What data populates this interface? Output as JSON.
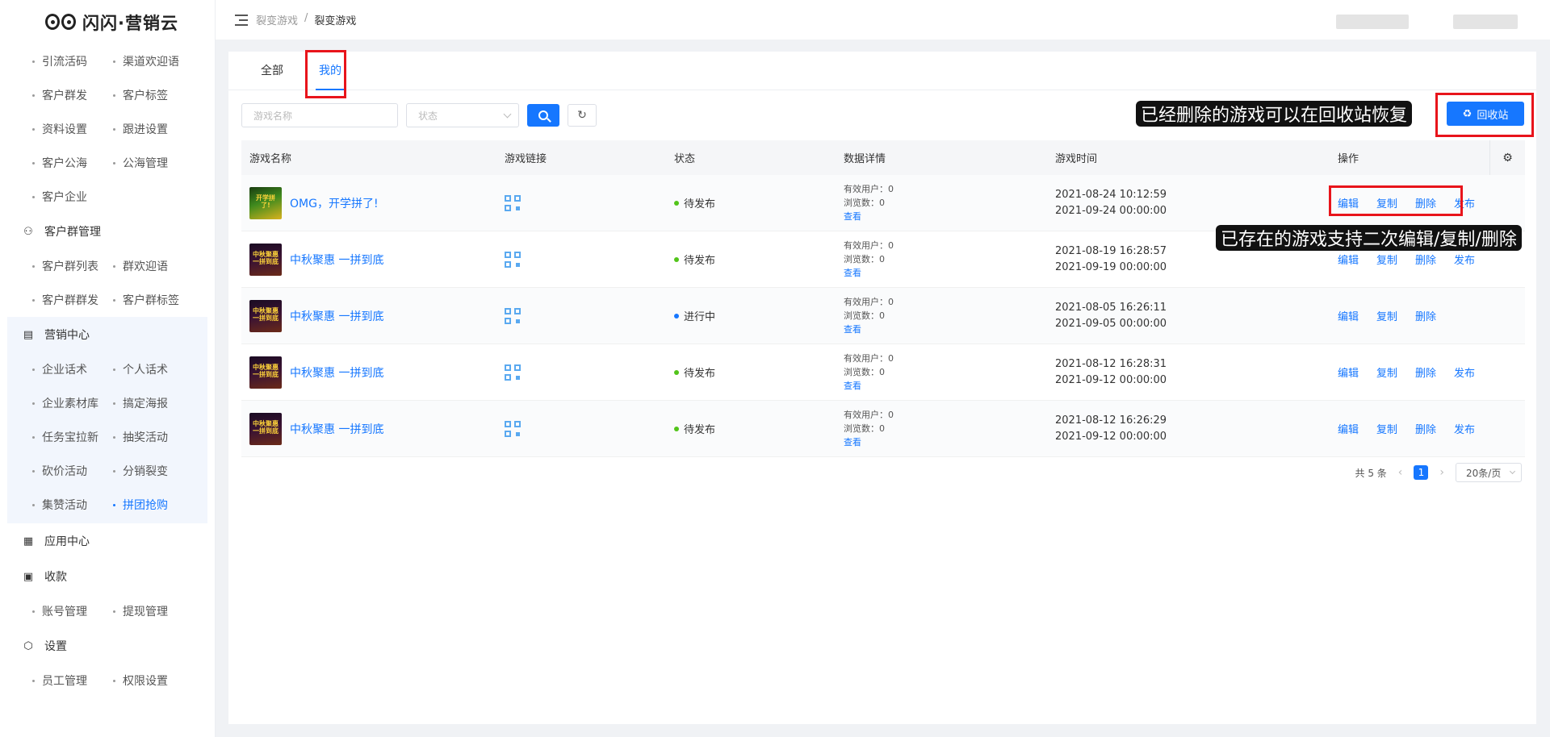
{
  "brand": {
    "name": "闪闪·营销云"
  },
  "sidebar": {
    "top_items": [
      "引流活码",
      "渠道欢迎语",
      "客户群发",
      "客户标签",
      "资料设置",
      "跟进设置",
      "客户公海",
      "公海管理",
      "客户企业"
    ],
    "groups": [
      {
        "title": "客户群管理",
        "icon": "group-users-icon",
        "items": [
          "客户群列表",
          "群欢迎语",
          "客户群群发",
          "客户群标签"
        ]
      },
      {
        "title": "营销中心",
        "icon": "chart-line-icon",
        "items": [
          "企业话术",
          "个人话术",
          "企业素材库",
          "搞定海报",
          "任务宝拉新",
          "抽奖活动",
          "砍价活动",
          "分销裂变",
          "集赞活动",
          "拼团抢购"
        ],
        "active_item": "拼团抢购"
      },
      {
        "title": "应用中心",
        "icon": "apps-grid-icon",
        "items": []
      },
      {
        "title": "收款",
        "icon": "wallet-icon",
        "items": [
          "账号管理",
          "提现管理"
        ]
      },
      {
        "title": "设置",
        "icon": "settings-hex-icon",
        "items": [
          "员工管理",
          "权限设置"
        ]
      }
    ]
  },
  "header": {
    "breadcrumb": [
      "裂变游戏",
      "裂变游戏"
    ]
  },
  "tabs": [
    {
      "label": "全部",
      "active": false
    },
    {
      "label": "我的",
      "active": true
    }
  ],
  "filters": {
    "name_placeholder": "游戏名称",
    "status_placeholder": "状态"
  },
  "recycle_button": "回收站",
  "annotations": {
    "recycle_hint": "已经删除的游戏可以在回收站恢复",
    "ops_hint": "已存在的游戏支持二次编辑/复制/删除"
  },
  "table": {
    "columns": [
      "游戏名称",
      "游戏链接",
      "状态",
      "数据详情",
      "游戏时间",
      "操作"
    ],
    "rows": [
      {
        "name": "OMG，开学拼了!",
        "thumb_text": "开学拼了!",
        "status": "待发布",
        "status_color": "#52c41a",
        "valid_users": "有效用户：0",
        "views": "浏览数：0",
        "view_link": "查看",
        "start": "2021-08-24 10:12:59",
        "end": "2021-09-24 00:00:00",
        "ops": [
          "编辑",
          "复制",
          "删除",
          "发布"
        ]
      },
      {
        "name": "中秋聚惠 一拼到底",
        "thumb_text": "中秋聚惠 一拼到底",
        "status": "待发布",
        "status_color": "#52c41a",
        "valid_users": "有效用户：0",
        "views": "浏览数：0",
        "view_link": "查看",
        "start": "2021-08-19 16:28:57",
        "end": "2021-09-19 00:00:00",
        "ops": [
          "编辑",
          "复制",
          "删除",
          "发布"
        ]
      },
      {
        "name": "中秋聚惠 一拼到底",
        "thumb_text": "中秋聚惠 一拼到底",
        "status": "进行中",
        "status_color": "#1677ff",
        "valid_users": "有效用户：0",
        "views": "浏览数：0",
        "view_link": "查看",
        "start": "2021-08-05 16:26:11",
        "end": "2021-09-05 00:00:00",
        "ops": [
          "编辑",
          "复制",
          "删除"
        ]
      },
      {
        "name": "中秋聚惠 一拼到底",
        "thumb_text": "中秋聚惠 一拼到底",
        "status": "待发布",
        "status_color": "#52c41a",
        "valid_users": "有效用户：0",
        "views": "浏览数：0",
        "view_link": "查看",
        "start": "2021-08-12 16:28:31",
        "end": "2021-09-12 00:00:00",
        "ops": [
          "编辑",
          "复制",
          "删除",
          "发布"
        ]
      },
      {
        "name": "中秋聚惠 一拼到底",
        "thumb_text": "中秋聚惠 一拼到底",
        "status": "待发布",
        "status_color": "#52c41a",
        "valid_users": "有效用户：0",
        "views": "浏览数：0",
        "view_link": "查看",
        "start": "2021-08-12 16:26:29",
        "end": "2021-09-12 00:00:00",
        "ops": [
          "编辑",
          "复制",
          "删除",
          "发布"
        ]
      }
    ]
  },
  "pagination": {
    "total": "共 5 条",
    "current": "1",
    "page_size": "20条/页"
  },
  "colors": {
    "primary": "#1677ff",
    "highlight": "#e8141b"
  }
}
